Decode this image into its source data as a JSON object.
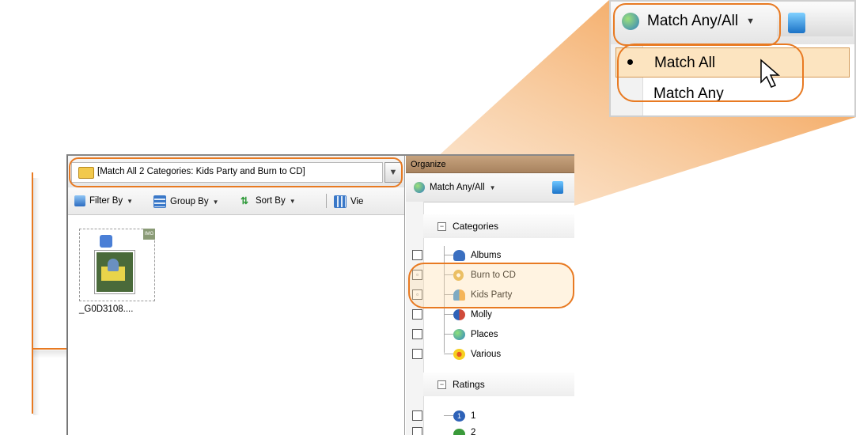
{
  "address": {
    "text": "[Match All 2 Categories: Kids Party and Burn to CD]",
    "dropdown_glyph": "▼"
  },
  "toolbar": {
    "filter_label": "Filter By",
    "group_label": "Group By",
    "sort_label": "Sort By",
    "view_label": "Vie"
  },
  "thumbnail": {
    "label": "_G0D3108....",
    "badge": "IMG"
  },
  "organize": {
    "title": "Organize",
    "match_button": "Match Any/All",
    "categories_header": "Categories",
    "ratings_header": "Ratings",
    "categories": [
      {
        "label": "Albums",
        "checked": false,
        "icon": "album-icon",
        "color": "#3a6fc0"
      },
      {
        "label": "Burn to CD",
        "checked": true,
        "icon": "cd-icon",
        "color": "#e0b040"
      },
      {
        "label": "Kids Party",
        "checked": true,
        "icon": "people-icon",
        "color": "#3a8fd0"
      },
      {
        "label": "Molly",
        "checked": false,
        "icon": "person-icon",
        "color": "#d04a3a"
      },
      {
        "label": "Places",
        "checked": false,
        "icon": "globe-icon",
        "color": "#3aa05a"
      },
      {
        "label": "Various",
        "checked": false,
        "icon": "flower-icon",
        "color": "#f0c020"
      }
    ],
    "ratings": [
      {
        "label": "1",
        "color": "#2e62b8"
      },
      {
        "label": "2",
        "color": "#3a9a3a"
      }
    ]
  },
  "zoom": {
    "match_button": "Match Any/All",
    "menu": [
      {
        "label": "Match All",
        "selected": true
      },
      {
        "label": "Match Any",
        "selected": false
      }
    ]
  },
  "colors": {
    "accent": "#e87a22",
    "highlight": "#fce4c0"
  }
}
